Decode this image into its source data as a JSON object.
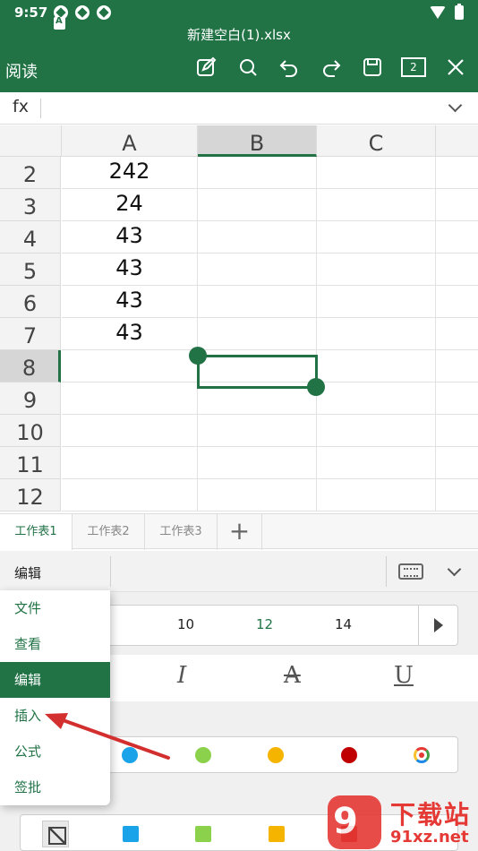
{
  "status_bar": {
    "time": "9:57"
  },
  "header": {
    "doc_title": "新建空白(1).xlsx",
    "mode": "阅读",
    "sheet_count_badge": "2"
  },
  "formula_bar": {
    "fx_label": "fx",
    "value": ""
  },
  "grid": {
    "columns": [
      "A",
      "B",
      "C"
    ],
    "selected_column": "B",
    "rows": [
      {
        "num": "2",
        "a": "242"
      },
      {
        "num": "3",
        "a": "24"
      },
      {
        "num": "4",
        "a": "43"
      },
      {
        "num": "5",
        "a": "43"
      },
      {
        "num": "6",
        "a": "43"
      },
      {
        "num": "7",
        "a": "43"
      },
      {
        "num": "8",
        "a": ""
      },
      {
        "num": "9",
        "a": ""
      },
      {
        "num": "10",
        "a": ""
      },
      {
        "num": "11",
        "a": ""
      },
      {
        "num": "12",
        "a": ""
      }
    ],
    "selected_row": "8"
  },
  "sheet_tabs": {
    "tabs": [
      "工作表1",
      "工作表2",
      "工作表3"
    ],
    "active": "工作表1",
    "add_label": "+"
  },
  "panel": {
    "label": "编辑",
    "font_sizes": [
      "10",
      "12",
      "14"
    ],
    "active_size": "12",
    "format_buttons": {
      "italic": "I",
      "strike": "A",
      "underline": "U"
    },
    "font_colors": [
      "#1aa3e8",
      "#8bd14b",
      "#f5b400",
      "#c00000"
    ],
    "fill_colors": [
      "#1aa3e8",
      "#8bd14b",
      "#f5b400",
      "#c00000"
    ]
  },
  "menu": {
    "items": [
      "文件",
      "查看",
      "编辑",
      "插入",
      "公式",
      "签批"
    ],
    "active": "编辑",
    "highlighted": "插入"
  },
  "watermark": {
    "logo": "9",
    "brand": "下载站",
    "domain": "91xz.net"
  },
  "colors": {
    "brand_green": "#217346",
    "arrow_red": "#d32f2f"
  }
}
